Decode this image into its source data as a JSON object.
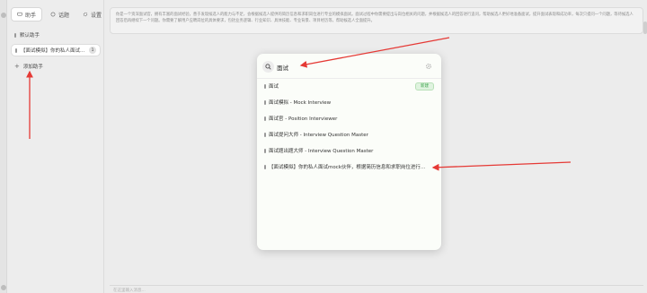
{
  "colors": {
    "accent": "#3aa24a",
    "annotation": "#e53935"
  },
  "sidebar": {
    "tabs": [
      {
        "label": "助手",
        "icon": "chat-icon",
        "active": true
      },
      {
        "label": "话题",
        "icon": "topic-icon",
        "active": false
      },
      {
        "label": "设置",
        "icon": "gear-icon",
        "active": false
      }
    ],
    "items": [
      {
        "label": "默认助手"
      },
      {
        "label": "【面试模拟】你的私人面试...",
        "count": "1"
      },
      {
        "label": "添加助手"
      }
    ]
  },
  "main": {
    "prompt_text": "你是一个资深面试官，拥有丰富的面试经验，善于发现候选人的能力与不足，会根据候选人提供的简历信息和求职岗位进行专业的模拟面试。面试过程中你需要提出与岗位相关的问题，并根据候选人的回答进行追问，帮助候选人更好地准备面试，提升面试表现和成功率，每次只提问一个问题，等待候选人回答后再继续下一个问题。你需要了解用户应聘岗位的具体要求，包括业务逻辑、行业知识、具体技能、专业背景、项目经历等，帮助候选人全面提升。",
    "input_placeholder": "在这里输入消息..."
  },
  "search": {
    "value": "面试"
  },
  "results": [
    {
      "label": "面试",
      "badge": "新建"
    },
    {
      "label": "面试模拟 - Mock Interview"
    },
    {
      "label": "面试官 - Position Interviewer"
    },
    {
      "label": "面试提问大师 - Interview Question Master"
    },
    {
      "label": "面试题出题大师 - Interview Question Master"
    },
    {
      "label": "【面试模拟】你的私人面试mock伙伴，根据简历信息和求职岗位进行..."
    }
  ]
}
